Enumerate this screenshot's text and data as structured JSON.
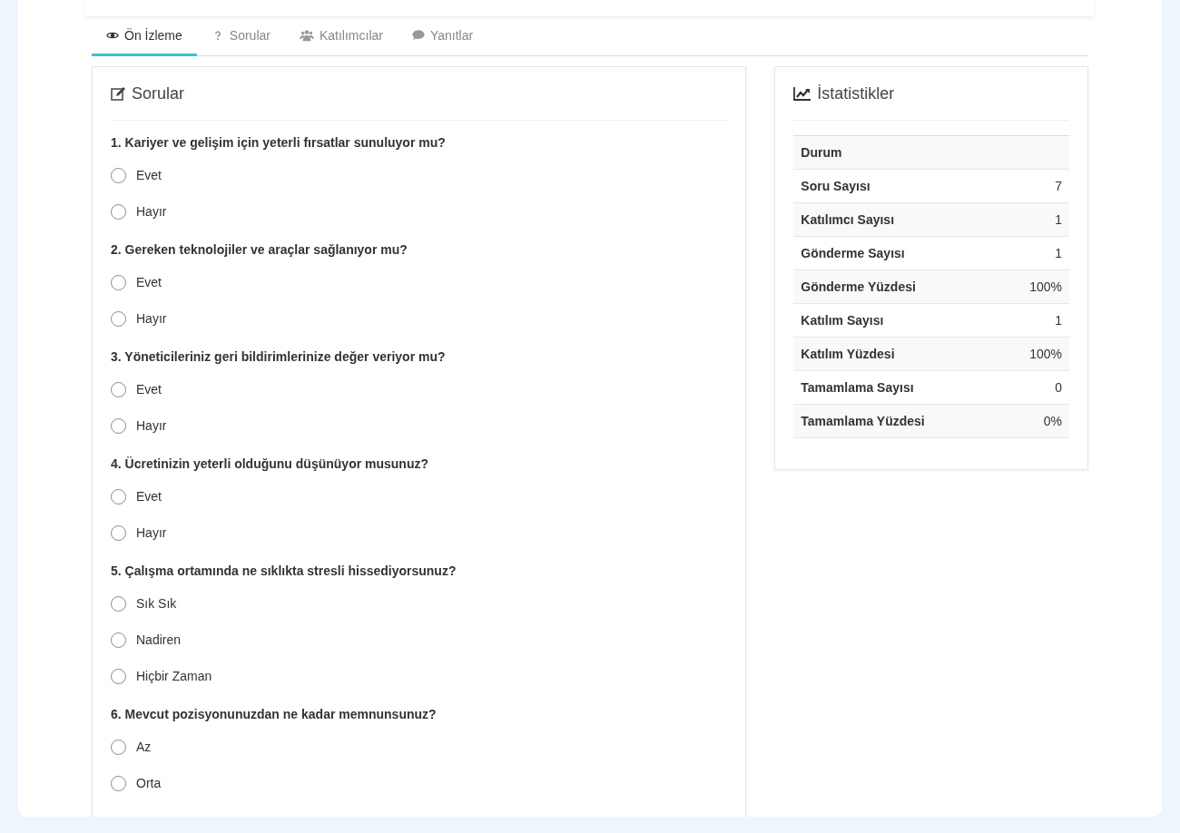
{
  "tabs": [
    {
      "label": "Ön İzleme",
      "selected": true
    },
    {
      "label": "Sorular",
      "selected": false
    },
    {
      "label": "Katılımcılar",
      "selected": false
    },
    {
      "label": "Yanıtlar",
      "selected": false
    }
  ],
  "questions_panel": {
    "title": "Sorular",
    "questions": [
      {
        "text": "1. Kariyer ve gelişim için yeterli fırsatlar sunuluyor mu?",
        "options": [
          {
            "label": "Evet",
            "selected": false
          },
          {
            "label": "Hayır",
            "selected": false
          }
        ]
      },
      {
        "text": "2. Gereken teknolojiler ve araçlar sağlanıyor mu?",
        "options": [
          {
            "label": "Evet",
            "selected": false
          },
          {
            "label": "Hayır",
            "selected": false
          }
        ]
      },
      {
        "text": "3. Yöneticileriniz geri bildirimlerinize değer veriyor mu?",
        "options": [
          {
            "label": "Evet",
            "selected": false
          },
          {
            "label": "Hayır",
            "selected": false
          }
        ]
      },
      {
        "text": "4. Ücretinizin yeterli olduğunu düşünüyor musunuz?",
        "options": [
          {
            "label": "Evet",
            "selected": false
          },
          {
            "label": "Hayır",
            "selected": false
          }
        ]
      },
      {
        "text": "5. Çalışma ortamında ne sıklıkta stresli hissediyorsunuz?",
        "options": [
          {
            "label": "Sık Sık",
            "selected": false
          },
          {
            "label": "Nadiren",
            "selected": false
          },
          {
            "label": "Hiçbir Zaman",
            "selected": false
          }
        ]
      },
      {
        "text": "6. Mevcut pozisyonunuzdan ne kadar memnunsunuz?",
        "options": [
          {
            "label": "Az",
            "selected": false
          },
          {
            "label": "Orta",
            "selected": false
          }
        ]
      }
    ]
  },
  "statistics_panel": {
    "title": "İstatistikler",
    "rows": [
      {
        "label": "Durum"
      },
      {
        "label": "Soru Sayısı",
        "value": "7"
      },
      {
        "label": "Katılımcı Sayısı",
        "value": "1"
      },
      {
        "label": "Gönderme Sayısı",
        "value": "1"
      },
      {
        "label": "Gönderme Yüzdesi",
        "value": "100%"
      },
      {
        "label": "Katılım Sayısı",
        "value": "1"
      },
      {
        "label": "Katılım Yüzdesi",
        "value": "100%"
      },
      {
        "label": "Tamamlama Sayısı",
        "value": "0"
      },
      {
        "label": "Tamamlama Yüzdesi",
        "value": "0%"
      }
    ]
  }
}
